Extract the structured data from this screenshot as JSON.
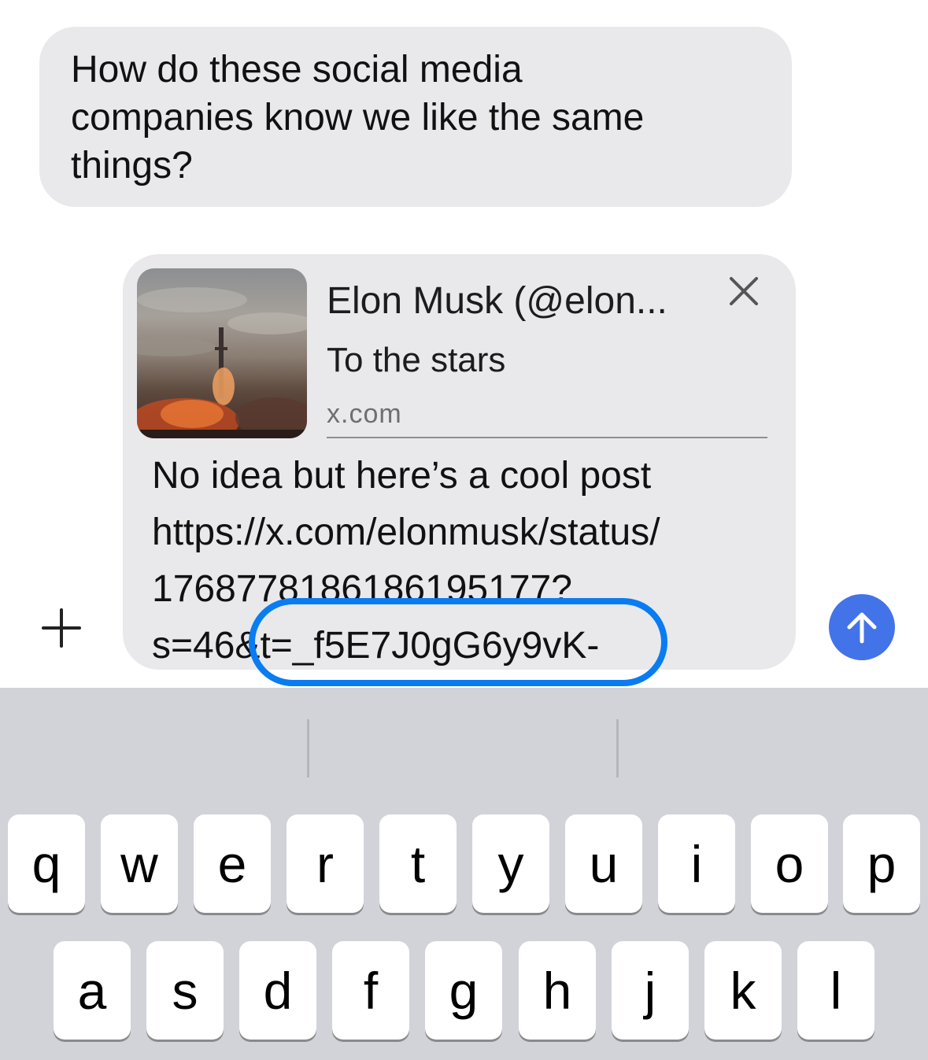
{
  "messages": [
    {
      "text": "How do these social media\ncompanies know we like the same\nthings?"
    }
  ],
  "link_preview": {
    "title": "Elon Musk (@elon...",
    "subtitle": "To the stars",
    "domain": "x.com"
  },
  "compose": {
    "text": "No idea but here’s a cool post\nhttps://x.com/elonmusk/status/\n1768778186186195177?\ns=46&t=_f5E7J0gG6y9vK-"
  },
  "colors": {
    "bubble": "#e9e9eb",
    "send_button": "#4373e8",
    "highlight_ring": "#0a7cf2",
    "keyboard_bg": "#d1d3d9"
  },
  "icons": {
    "add": "plus-icon",
    "close": "close-icon",
    "send": "arrow-up-icon"
  },
  "keyboard": {
    "row1": [
      "q",
      "w",
      "e",
      "r",
      "t",
      "y",
      "u",
      "i",
      "o",
      "p"
    ],
    "row2": [
      "a",
      "s",
      "d",
      "f",
      "g",
      "h",
      "j",
      "k",
      "l"
    ]
  }
}
